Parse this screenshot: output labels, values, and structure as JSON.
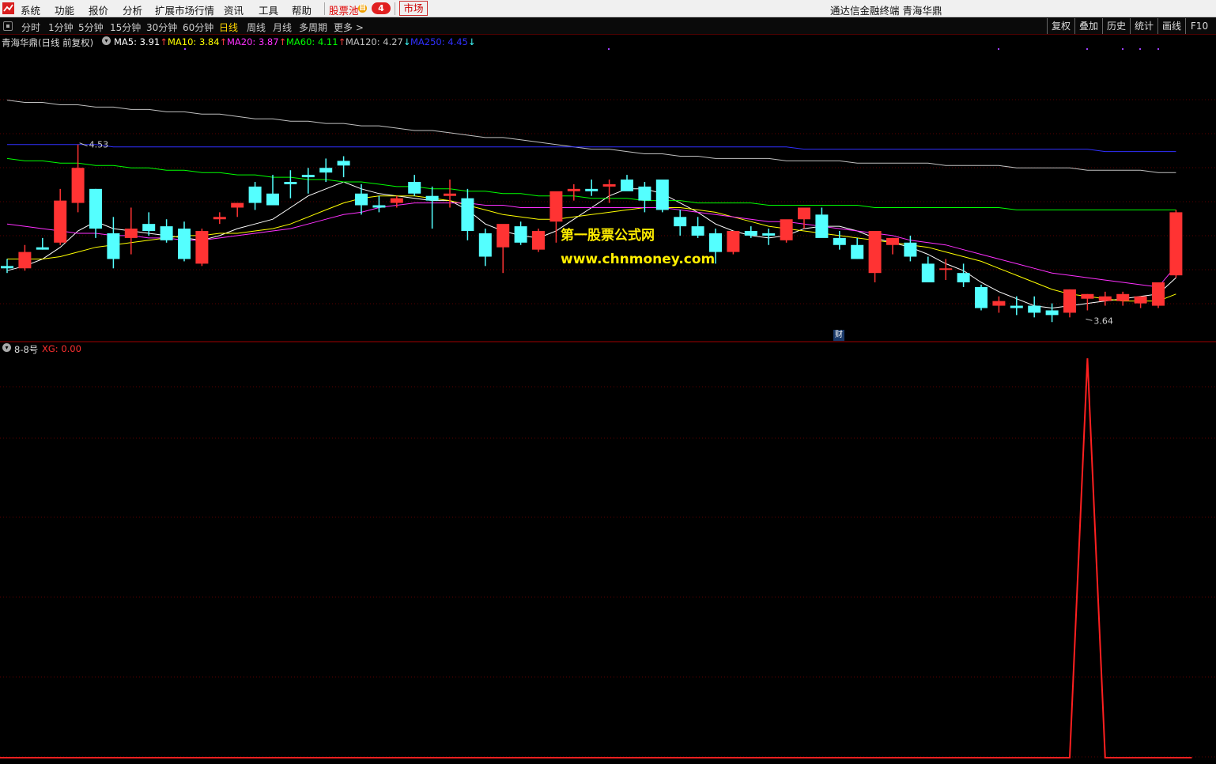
{
  "menu": {
    "items": [
      "系统",
      "功能",
      "报价",
      "分析",
      "扩展市场行情",
      "资讯",
      "工具",
      "帮助"
    ],
    "stock_pool": "股票池",
    "pool_icon": "自",
    "pool_count": "4",
    "market": "市场",
    "app_title": "通达信金融终端  青海华鼎"
  },
  "toolbar": {
    "periods": [
      "分时",
      "1分钟",
      "5分钟",
      "15分钟",
      "30分钟",
      "60分钟",
      "日线",
      "周线",
      "月线",
      "多周期",
      "更多 >"
    ],
    "active_period": "日线",
    "right_buttons": [
      "复权",
      "叠加",
      "历史",
      "统计",
      "画线",
      "F10"
    ]
  },
  "main_chart": {
    "title": "青海华鼎(日线 前复权)",
    "ma_legend": [
      {
        "label": "MA5: 3.91",
        "arrow": "↑",
        "color": "#ffffff",
        "arrow_color": "#ff4040"
      },
      {
        "label": "MA10: 3.84",
        "arrow": "↑",
        "color": "#ffff00",
        "arrow_color": "#ff4040"
      },
      {
        "label": "MA20: 3.87",
        "arrow": "↑",
        "color": "#ff30ff",
        "arrow_color": "#ff4040"
      },
      {
        "label": "MA60: 4.11",
        "arrow": "↑",
        "color": "#00ff00",
        "arrow_color": "#ff4040"
      },
      {
        "label": "MA120: 4.27",
        "arrow": "↓",
        "color": "#c0c0c0",
        "arrow_color": "#40ffff"
      },
      {
        "label": "MA250: 4.45",
        "arrow": "↓",
        "color": "#3030ff",
        "arrow_color": "#40ffff"
      }
    ],
    "high_label": "4.53",
    "low_label": "3.64",
    "cai_marker": "财",
    "watermark_cn": "第一股票公式网",
    "watermark_url": "www.chnmoney.com"
  },
  "sub_chart": {
    "title": "8-8号",
    "indicator_label": "XG: 0.00"
  },
  "chart_data": [
    {
      "type": "candlestick",
      "title": "青海华鼎(日线 前复权)",
      "ylim": [
        3.58,
        4.67
      ],
      "columns": [
        "open",
        "high",
        "low",
        "close"
      ],
      "candles": [
        [
          3.87,
          3.9,
          3.84,
          3.86
        ],
        [
          3.86,
          3.96,
          3.85,
          3.93
        ],
        [
          3.95,
          3.99,
          3.94,
          3.94
        ],
        [
          3.97,
          4.2,
          3.96,
          4.15
        ],
        [
          4.14,
          4.39,
          4.1,
          4.29
        ],
        [
          4.2,
          4.2,
          3.99,
          4.03
        ],
        [
          4.01,
          4.08,
          3.86,
          3.9
        ],
        [
          3.99,
          4.12,
          3.92,
          4.03
        ],
        [
          4.05,
          4.1,
          4.0,
          4.02
        ],
        [
          4.04,
          4.07,
          3.97,
          3.98
        ],
        [
          4.03,
          4.06,
          3.89,
          3.9
        ],
        [
          3.88,
          4.03,
          3.87,
          4.02
        ],
        [
          4.07,
          4.1,
          4.05,
          4.08
        ],
        [
          4.12,
          4.14,
          4.08,
          4.14
        ],
        [
          4.21,
          4.23,
          4.11,
          4.14
        ],
        [
          4.18,
          4.26,
          4.13,
          4.13
        ],
        [
          4.23,
          4.28,
          4.16,
          4.22
        ],
        [
          4.26,
          4.29,
          4.18,
          4.25
        ],
        [
          4.29,
          4.33,
          4.23,
          4.27
        ],
        [
          4.32,
          4.34,
          4.25,
          4.3
        ],
        [
          4.18,
          4.22,
          4.09,
          4.13
        ],
        [
          4.13,
          4.17,
          4.1,
          4.12
        ],
        [
          4.14,
          4.17,
          4.12,
          4.16
        ],
        [
          4.23,
          4.26,
          4.17,
          4.18
        ],
        [
          4.17,
          4.21,
          4.03,
          4.15
        ],
        [
          4.17,
          4.24,
          4.12,
          4.18
        ],
        [
          4.16,
          4.2,
          3.98,
          4.02
        ],
        [
          4.01,
          4.03,
          3.87,
          3.91
        ],
        [
          3.95,
          4.04,
          3.84,
          4.05
        ],
        [
          4.04,
          4.06,
          3.96,
          3.97
        ],
        [
          3.94,
          4.03,
          3.93,
          4.02
        ],
        [
          4.06,
          4.06,
          3.97,
          4.19
        ],
        [
          4.19,
          4.22,
          4.15,
          4.2
        ],
        [
          4.2,
          4.24,
          4.17,
          4.19
        ],
        [
          4.21,
          4.24,
          4.14,
          4.22
        ],
        [
          4.24,
          4.26,
          4.2,
          4.19
        ],
        [
          4.21,
          4.23,
          4.1,
          4.15
        ],
        [
          4.24,
          4.22,
          4.1,
          4.11
        ],
        [
          4.08,
          4.11,
          4.0,
          4.04
        ],
        [
          4.04,
          4.08,
          3.99,
          4.0
        ],
        [
          4.01,
          4.03,
          3.88,
          3.93
        ],
        [
          3.93,
          4.02,
          3.92,
          4.02
        ],
        [
          4.02,
          4.04,
          3.99,
          4.0
        ],
        [
          4.01,
          4.03,
          3.96,
          4.0
        ],
        [
          3.98,
          4.06,
          3.97,
          4.07
        ],
        [
          4.07,
          4.09,
          4.03,
          4.12
        ],
        [
          4.09,
          4.12,
          4.03,
          3.99
        ],
        [
          3.99,
          4.02,
          3.94,
          3.96
        ],
        [
          3.96,
          3.99,
          3.9,
          3.9
        ],
        [
          3.84,
          3.96,
          3.8,
          4.02
        ],
        [
          3.96,
          3.99,
          3.92,
          3.99
        ],
        [
          3.97,
          4.0,
          3.89,
          3.91
        ],
        [
          3.88,
          3.91,
          3.8,
          3.8
        ],
        [
          3.86,
          3.9,
          3.81,
          3.86
        ],
        [
          3.84,
          3.88,
          3.78,
          3.8
        ],
        [
          3.78,
          3.79,
          3.68,
          3.69
        ],
        [
          3.7,
          3.74,
          3.67,
          3.72
        ],
        [
          3.7,
          3.74,
          3.66,
          3.69
        ],
        [
          3.7,
          3.74,
          3.65,
          3.67
        ],
        [
          3.68,
          3.71,
          3.63,
          3.66
        ],
        [
          3.67,
          3.77,
          3.65,
          3.77
        ],
        [
          3.73,
          3.75,
          3.68,
          3.75
        ],
        [
          3.72,
          3.76,
          3.7,
          3.74
        ],
        [
          3.72,
          3.76,
          3.7,
          3.75
        ],
        [
          3.71,
          3.74,
          3.69,
          3.74
        ],
        [
          3.7,
          3.77,
          3.69,
          3.8
        ],
        [
          3.83,
          4.11,
          3.82,
          4.1
        ]
      ],
      "ma": {
        "MA5": [
          3.85,
          3.87,
          3.9,
          3.95,
          4.02,
          4.06,
          4.03,
          4.02,
          4.01,
          4.0,
          3.99,
          3.98,
          4.0,
          4.03,
          4.05,
          4.07,
          4.12,
          4.17,
          4.2,
          4.23,
          4.2,
          4.18,
          4.17,
          4.16,
          4.15,
          4.15,
          4.11,
          4.05,
          4.02,
          4.0,
          3.99,
          4.02,
          4.07,
          4.12,
          4.17,
          4.2,
          4.2,
          4.18,
          4.14,
          4.1,
          4.05,
          4.02,
          4.0,
          3.99,
          4.0,
          4.03,
          4.04,
          4.04,
          4.02,
          3.99,
          3.97,
          3.95,
          3.92,
          3.88,
          3.85,
          3.8,
          3.76,
          3.73,
          3.7,
          3.69,
          3.7,
          3.71,
          3.72,
          3.73,
          3.74,
          3.75,
          3.82
        ],
        "MA10": [
          3.9,
          3.9,
          3.9,
          3.91,
          3.93,
          3.95,
          3.96,
          3.97,
          3.98,
          3.99,
          4.0,
          4.0,
          4.01,
          4.01,
          4.02,
          4.03,
          4.05,
          4.08,
          4.11,
          4.14,
          4.16,
          4.17,
          4.17,
          4.17,
          4.16,
          4.15,
          4.13,
          4.11,
          4.09,
          4.08,
          4.07,
          4.07,
          4.08,
          4.09,
          4.1,
          4.11,
          4.12,
          4.12,
          4.12,
          4.11,
          4.1,
          4.08,
          4.06,
          4.04,
          4.03,
          4.02,
          4.01,
          4.0,
          3.99,
          3.98,
          3.97,
          3.96,
          3.95,
          3.93,
          3.91,
          3.89,
          3.86,
          3.83,
          3.8,
          3.77,
          3.75,
          3.74,
          3.73,
          3.72,
          3.72,
          3.72,
          3.75
        ],
        "MA20": [
          4.05,
          4.04,
          4.03,
          4.02,
          4.01,
          4.01,
          4.0,
          4.0,
          3.99,
          3.99,
          3.98,
          3.98,
          3.99,
          4.0,
          4.01,
          4.02,
          4.03,
          4.05,
          4.07,
          4.09,
          4.1,
          4.12,
          4.13,
          4.14,
          4.14,
          4.14,
          4.14,
          4.13,
          4.13,
          4.12,
          4.12,
          4.12,
          4.12,
          4.12,
          4.12,
          4.12,
          4.12,
          4.12,
          4.11,
          4.1,
          4.09,
          4.08,
          4.07,
          4.06,
          4.06,
          4.05,
          4.04,
          4.03,
          4.02,
          4.01,
          4.0,
          3.98,
          3.97,
          3.96,
          3.94,
          3.92,
          3.9,
          3.88,
          3.86,
          3.84,
          3.83,
          3.82,
          3.81,
          3.8,
          3.79,
          3.78,
          3.87
        ],
        "MA60": [
          4.33,
          4.32,
          4.32,
          4.31,
          4.31,
          4.3,
          4.3,
          4.29,
          4.29,
          4.28,
          4.28,
          4.27,
          4.27,
          4.26,
          4.26,
          4.25,
          4.25,
          4.24,
          4.24,
          4.23,
          4.23,
          4.22,
          4.21,
          4.21,
          4.2,
          4.2,
          4.19,
          4.19,
          4.18,
          4.18,
          4.17,
          4.17,
          4.17,
          4.16,
          4.16,
          4.16,
          4.15,
          4.15,
          4.15,
          4.14,
          4.14,
          4.14,
          4.14,
          4.13,
          4.13,
          4.13,
          4.13,
          4.13,
          4.13,
          4.12,
          4.12,
          4.12,
          4.12,
          4.12,
          4.12,
          4.12,
          4.12,
          4.11,
          4.11,
          4.11,
          4.11,
          4.11,
          4.11,
          4.11,
          4.11,
          4.11,
          4.11
        ],
        "MA120": [
          4.58,
          4.57,
          4.57,
          4.56,
          4.56,
          4.55,
          4.55,
          4.54,
          4.54,
          4.53,
          4.53,
          4.52,
          4.52,
          4.51,
          4.5,
          4.5,
          4.49,
          4.49,
          4.48,
          4.48,
          4.47,
          4.47,
          4.46,
          4.45,
          4.45,
          4.44,
          4.43,
          4.42,
          4.42,
          4.41,
          4.4,
          4.39,
          4.38,
          4.37,
          4.37,
          4.36,
          4.35,
          4.35,
          4.34,
          4.34,
          4.33,
          4.33,
          4.33,
          4.33,
          4.32,
          4.32,
          4.32,
          4.32,
          4.31,
          4.31,
          4.31,
          4.31,
          4.31,
          4.3,
          4.3,
          4.3,
          4.3,
          4.29,
          4.29,
          4.29,
          4.29,
          4.28,
          4.28,
          4.28,
          4.28,
          4.27,
          4.27
        ],
        "MA250": [
          4.39,
          4.39,
          4.39,
          4.39,
          4.39,
          4.39,
          4.38,
          4.38,
          4.38,
          4.38,
          4.38,
          4.38,
          4.38,
          4.38,
          4.38,
          4.38,
          4.38,
          4.38,
          4.38,
          4.38,
          4.38,
          4.38,
          4.38,
          4.38,
          4.38,
          4.38,
          4.38,
          4.38,
          4.38,
          4.38,
          4.38,
          4.38,
          4.38,
          4.38,
          4.38,
          4.38,
          4.38,
          4.38,
          4.38,
          4.38,
          4.38,
          4.38,
          4.38,
          4.38,
          4.38,
          4.37,
          4.37,
          4.37,
          4.37,
          4.37,
          4.37,
          4.37,
          4.37,
          4.37,
          4.37,
          4.37,
          4.37,
          4.37,
          4.37,
          4.37,
          4.37,
          4.37,
          4.36,
          4.36,
          4.36,
          4.36,
          4.36
        ]
      },
      "ma_colors": {
        "MA5": "#ffffff",
        "MA10": "#ffff00",
        "MA20": "#ff30ff",
        "MA60": "#00ff00",
        "MA120": "#c0c0c0",
        "MA250": "#3030ff"
      },
      "up_color": "#ff3333",
      "down_color": "#54ffff"
    },
    {
      "type": "line",
      "title": "8-8号",
      "series": [
        {
          "name": "XG",
          "values": [
            0,
            0,
            0,
            0,
            0,
            0,
            0,
            0,
            0,
            0,
            0,
            0,
            0,
            0,
            0,
            0,
            0,
            0,
            0,
            0,
            0,
            0,
            0,
            0,
            0,
            0,
            0,
            0,
            0,
            0,
            0,
            0,
            0,
            0,
            0,
            0,
            0,
            0,
            0,
            0,
            0,
            0,
            0,
            0,
            0,
            0,
            0,
            0,
            0,
            0,
            0,
            0,
            0,
            0,
            0,
            0,
            0,
            0,
            0,
            0,
            0,
            1,
            0,
            0,
            0,
            0,
            0
          ]
        }
      ],
      "ylim": [
        0,
        1
      ],
      "color": "#ff2020"
    }
  ]
}
